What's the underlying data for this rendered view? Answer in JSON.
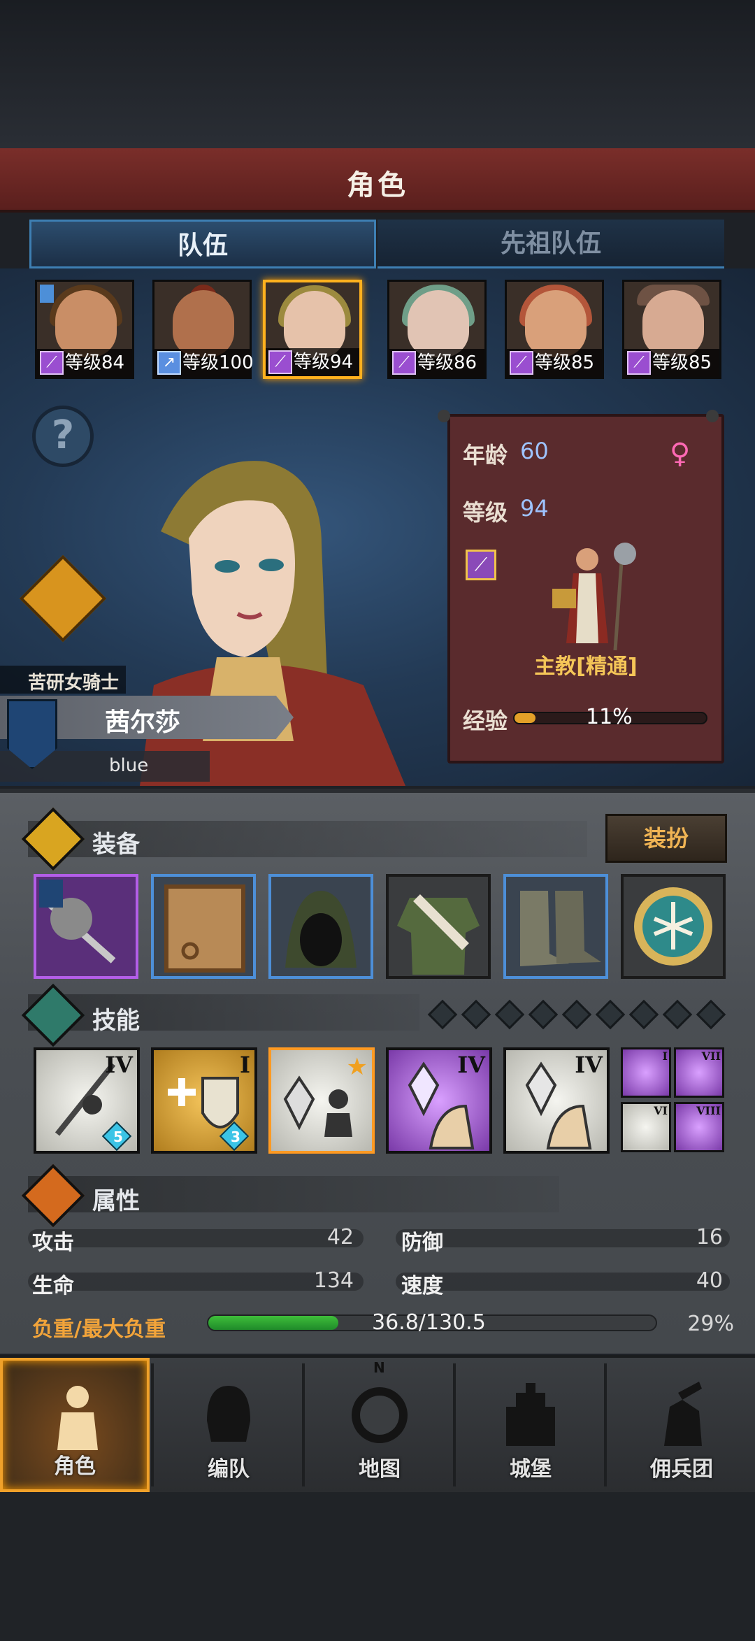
{
  "header": {
    "title": "角色"
  },
  "tabs": [
    {
      "label": "队伍",
      "active": true
    },
    {
      "label": "先祖队伍",
      "active": false
    }
  ],
  "party": [
    {
      "level_text": "等级84",
      "class_icon": "staff-icon",
      "selected": false
    },
    {
      "level_text": "等级100",
      "class_icon": "spear-icon",
      "selected": false
    },
    {
      "level_text": "等级94",
      "class_icon": "staff-icon",
      "selected": true
    },
    {
      "level_text": "等级86",
      "class_icon": "staff-icon",
      "selected": false
    },
    {
      "level_text": "等级85",
      "class_icon": "staff-icon",
      "selected": false
    },
    {
      "level_text": "等级85",
      "class_icon": "staff-icon",
      "selected": false
    }
  ],
  "character": {
    "subtitle": "苦研女骑士",
    "name": "茜尔莎",
    "player": "blue",
    "help_symbol": "?"
  },
  "info": {
    "age_label": "年龄",
    "age": "60",
    "gender_symbol": "♀",
    "level_label": "等级",
    "level": "94",
    "class_name": "主教[精通]",
    "exp_label": "经验",
    "exp_pct": "11%",
    "exp_fraction": 0.11
  },
  "equipment": {
    "title": "装备",
    "dress_button": "装扮"
  },
  "skills": {
    "title": "技能",
    "items": [
      {
        "roman": "IV",
        "badge": "5"
      },
      {
        "roman": "I",
        "badge": "3"
      },
      {
        "roman": "",
        "badge": ""
      },
      {
        "roman": "IV",
        "badge": ""
      },
      {
        "roman": "IV",
        "badge": ""
      }
    ],
    "minis": [
      "I",
      "VII",
      "VI",
      "VIII"
    ]
  },
  "attributes": {
    "title": "属性",
    "attack_label": "攻击",
    "attack": "42",
    "defense_label": "防御",
    "defense": "16",
    "hp_label": "生命",
    "hp": "134",
    "speed_label": "速度",
    "speed": "40",
    "load_label": "负重/最大负重",
    "load_value": "36.8/130.5",
    "load_pct": "29%",
    "load_fraction": 0.29
  },
  "nav": [
    {
      "label": "角色",
      "icon": "knight-icon",
      "active": true
    },
    {
      "label": "编队",
      "icon": "helmet-icon",
      "active": false
    },
    {
      "label": "地图",
      "icon": "compass-icon",
      "active": false
    },
    {
      "label": "城堡",
      "icon": "castle-icon",
      "active": false
    },
    {
      "label": "佣兵团",
      "icon": "mercenary-icon",
      "active": false
    }
  ],
  "nav_compass_n": "N",
  "colors": {
    "accent": "#ffb11e",
    "exp": "#e3a028",
    "load": "#3fbf3a",
    "tab_border": "#3e7fb3"
  }
}
